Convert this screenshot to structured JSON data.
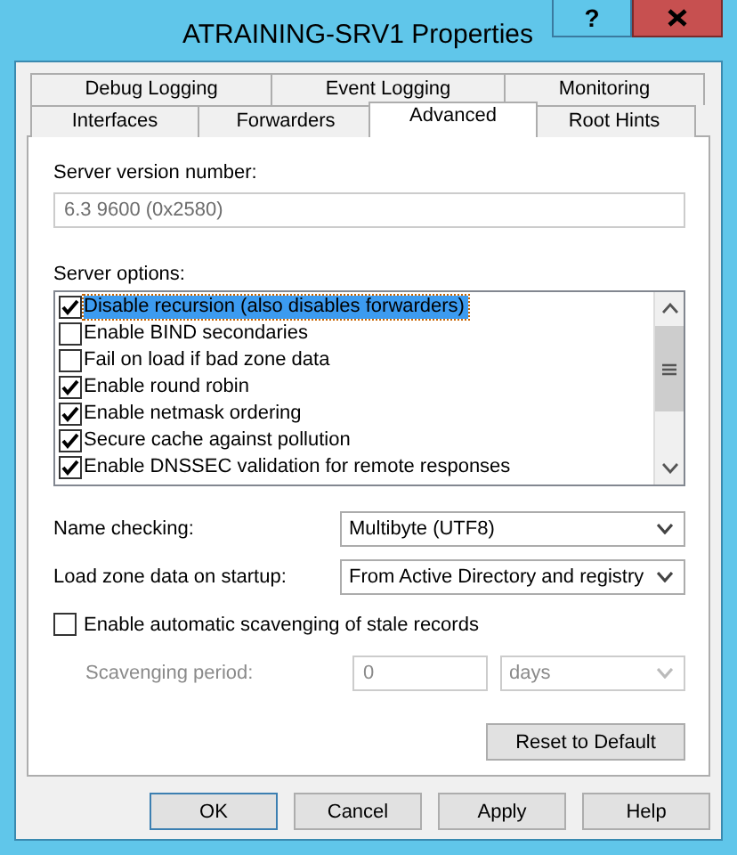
{
  "window": {
    "title": "ATRAINING-SRV1 Properties",
    "help_button": "?"
  },
  "tabs": [
    [
      {
        "label": "Debug Logging",
        "selected": false
      },
      {
        "label": "Event Logging",
        "selected": false
      },
      {
        "label": "Monitoring",
        "selected": false
      }
    ],
    [
      {
        "label": "Interfaces",
        "selected": false
      },
      {
        "label": "Forwarders",
        "selected": false
      },
      {
        "label": "Advanced",
        "selected": true
      },
      {
        "label": "Root Hints",
        "selected": false
      }
    ]
  ],
  "server_version": {
    "label": "Server version number:",
    "value": "6.3 9600 (0x2580)"
  },
  "server_options": {
    "label": "Server options:",
    "items": [
      {
        "label": "Disable recursion (also disables forwarders)",
        "checked": true,
        "selected": true
      },
      {
        "label": "Enable BIND secondaries",
        "checked": false,
        "selected": false
      },
      {
        "label": "Fail on load if bad zone data",
        "checked": false,
        "selected": false
      },
      {
        "label": "Enable round robin",
        "checked": true,
        "selected": false
      },
      {
        "label": "Enable netmask ordering",
        "checked": true,
        "selected": false
      },
      {
        "label": "Secure cache against pollution",
        "checked": true,
        "selected": false
      },
      {
        "label": "Enable DNSSEC validation for remote responses",
        "checked": true,
        "selected": false
      }
    ]
  },
  "name_checking": {
    "label": "Name checking:",
    "value": "Multibyte (UTF8)"
  },
  "load_zone_data": {
    "label": "Load zone data on startup:",
    "value": "From Active Directory and registry"
  },
  "scavenging": {
    "label": "Enable automatic scavenging of stale records",
    "checked": false,
    "period_label": "Scavenging period:",
    "period_value": "0",
    "unit": "days",
    "disabled": true
  },
  "reset_button": "Reset to Default",
  "buttons": [
    {
      "label": "OK",
      "default": true
    },
    {
      "label": "Cancel",
      "default": false
    },
    {
      "label": "Apply",
      "default": false
    },
    {
      "label": "Help",
      "default": false
    }
  ]
}
